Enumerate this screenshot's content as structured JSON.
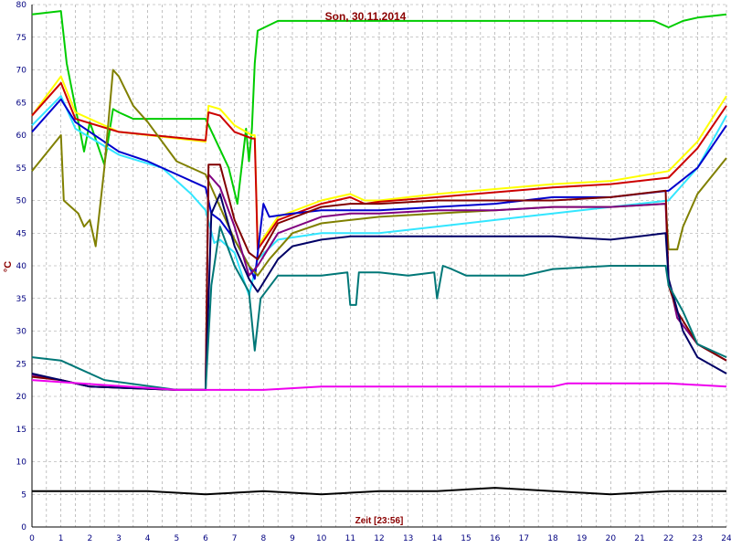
{
  "chart_data": {
    "type": "line",
    "title": "Son, 30.11.2014",
    "xlabel": "Zeit [23:56]",
    "ylabel": "°C",
    "xlim": [
      0,
      24
    ],
    "ylim": [
      0,
      80
    ],
    "x_ticks": [
      "0",
      "1",
      "2",
      "3",
      "4",
      "5",
      "6",
      "7",
      "8",
      "9",
      "10",
      "11",
      "12",
      "13",
      "14",
      "15",
      "16",
      "17",
      "18",
      "19",
      "20",
      "21",
      "22",
      "23",
      "24"
    ],
    "y_ticks": [
      "0",
      "5",
      "10",
      "15",
      "20",
      "25",
      "30",
      "35",
      "40",
      "45",
      "50",
      "55",
      "60",
      "65",
      "70",
      "75",
      "80"
    ],
    "x_minor_step": 0.5,
    "y_step": 5,
    "grid": true,
    "series": [
      {
        "color": "#00cc00",
        "points": [
          [
            0,
            78.5
          ],
          [
            1,
            79
          ],
          [
            1.2,
            71
          ],
          [
            1.6,
            62
          ],
          [
            1.8,
            57.5
          ],
          [
            2,
            62
          ],
          [
            2.5,
            55.5
          ],
          [
            2.8,
            64
          ],
          [
            3,
            63.5
          ],
          [
            3.5,
            62.5
          ],
          [
            4,
            62.5
          ],
          [
            5,
            62.5
          ],
          [
            6,
            62.5
          ],
          [
            6.8,
            55
          ],
          [
            7.1,
            49.5
          ],
          [
            7.4,
            61
          ],
          [
            7.5,
            56
          ],
          [
            7.6,
            61
          ],
          [
            7.7,
            71
          ],
          [
            7.8,
            76
          ],
          [
            8.5,
            77.5
          ],
          [
            9,
            77.5
          ],
          [
            10,
            77.5
          ],
          [
            15,
            77.5
          ],
          [
            20,
            77.5
          ],
          [
            21.5,
            77.5
          ],
          [
            22,
            76.5
          ],
          [
            22.5,
            77.5
          ],
          [
            23,
            78
          ],
          [
            24,
            78.5
          ]
        ]
      },
      {
        "color": "#ffff00",
        "points": [
          [
            0,
            63
          ],
          [
            1,
            69
          ],
          [
            1.5,
            63.5
          ],
          [
            3,
            60.5
          ],
          [
            6,
            59
          ],
          [
            6.1,
            64.5
          ],
          [
            6.5,
            64
          ],
          [
            7,
            61.5
          ],
          [
            7.6,
            60
          ],
          [
            7.7,
            60
          ],
          [
            7.8,
            43
          ],
          [
            8.5,
            47.5
          ],
          [
            10,
            50
          ],
          [
            11,
            51
          ],
          [
            11.5,
            50
          ],
          [
            12,
            50
          ],
          [
            14,
            51
          ],
          [
            18,
            52.5
          ],
          [
            20,
            53
          ],
          [
            22,
            54.5
          ],
          [
            23,
            59
          ],
          [
            24,
            66
          ]
        ]
      },
      {
        "color": "#cc0000",
        "points": [
          [
            0,
            63
          ],
          [
            1,
            68
          ],
          [
            1.5,
            62.5
          ],
          [
            3,
            60.5
          ],
          [
            6,
            59.2
          ],
          [
            6.1,
            63.5
          ],
          [
            6.5,
            63
          ],
          [
            7,
            60.5
          ],
          [
            7.6,
            59.5
          ],
          [
            7.7,
            59.5
          ],
          [
            7.8,
            42.5
          ],
          [
            8.5,
            47
          ],
          [
            10,
            49.5
          ],
          [
            11,
            50.5
          ],
          [
            11.5,
            49.5
          ],
          [
            12,
            49.8
          ],
          [
            14,
            50.5
          ],
          [
            18,
            52
          ],
          [
            20,
            52.5
          ],
          [
            22,
            53.5
          ],
          [
            23,
            58
          ],
          [
            24,
            64.5
          ]
        ]
      },
      {
        "color": "#33e6ff",
        "points": [
          [
            0,
            61.5
          ],
          [
            1,
            66
          ],
          [
            1.5,
            61
          ],
          [
            3,
            57
          ],
          [
            4.5,
            55
          ],
          [
            5.5,
            51
          ],
          [
            6,
            48.5
          ],
          [
            6.3,
            43.5
          ],
          [
            6.5,
            44
          ],
          [
            7,
            42
          ],
          [
            7.3,
            38
          ],
          [
            7.5,
            35.5
          ],
          [
            7.8,
            41
          ],
          [
            8.5,
            44
          ],
          [
            10,
            45
          ],
          [
            11,
            45
          ],
          [
            12,
            45
          ],
          [
            14,
            46
          ],
          [
            16,
            47
          ],
          [
            18,
            48
          ],
          [
            20,
            49
          ],
          [
            22,
            50
          ],
          [
            23,
            55
          ],
          [
            24,
            63
          ]
        ]
      },
      {
        "color": "#0000cc",
        "points": [
          [
            0,
            60.5
          ],
          [
            1,
            65.5
          ],
          [
            1.5,
            62
          ],
          [
            3,
            57.5
          ],
          [
            4,
            56
          ],
          [
            5,
            54
          ],
          [
            6,
            52
          ],
          [
            6.2,
            48
          ],
          [
            6.5,
            47
          ],
          [
            7,
            44
          ],
          [
            7.5,
            40
          ],
          [
            7.7,
            38
          ],
          [
            8,
            49.5
          ],
          [
            8.2,
            47.5
          ],
          [
            9,
            48
          ],
          [
            10,
            48.5
          ],
          [
            11,
            48.5
          ],
          [
            12,
            48.5
          ],
          [
            14,
            49
          ],
          [
            16,
            49.5
          ],
          [
            18,
            50.5
          ],
          [
            20,
            50.5
          ],
          [
            22,
            51.5
          ],
          [
            23,
            55
          ],
          [
            24,
            61.5
          ]
        ]
      },
      {
        "color": "#808000",
        "points": [
          [
            0,
            54.5
          ],
          [
            1,
            60
          ],
          [
            1.1,
            50
          ],
          [
            1.6,
            48
          ],
          [
            1.8,
            46
          ],
          [
            2,
            47
          ],
          [
            2.2,
            43
          ],
          [
            2.5,
            55
          ],
          [
            2.8,
            70
          ],
          [
            3,
            69
          ],
          [
            3.5,
            64.5
          ],
          [
            4,
            62
          ],
          [
            5,
            56
          ],
          [
            6,
            54
          ],
          [
            6.5,
            49
          ],
          [
            7,
            44
          ],
          [
            7.5,
            40
          ],
          [
            7.8,
            38.5
          ],
          [
            8.2,
            41
          ],
          [
            9,
            45
          ],
          [
            10,
            46.5
          ],
          [
            11,
            47
          ],
          [
            12,
            47.5
          ],
          [
            14,
            48
          ],
          [
            16,
            48.5
          ],
          [
            18,
            49
          ],
          [
            20,
            49
          ],
          [
            21.9,
            49.5
          ],
          [
            22,
            42.5
          ],
          [
            22.3,
            42.5
          ],
          [
            22.5,
            46
          ],
          [
            23,
            51
          ],
          [
            24,
            56.5
          ]
        ]
      },
      {
        "color": "#800080",
        "points": [
          [
            0,
            23.3
          ],
          [
            1,
            22.5
          ],
          [
            2,
            21.5
          ],
          [
            5,
            21
          ],
          [
            6,
            21
          ],
          [
            6.1,
            54
          ],
          [
            6.5,
            52
          ],
          [
            7,
            46
          ],
          [
            7.5,
            38.5
          ],
          [
            7.8,
            40
          ],
          [
            8.5,
            45
          ],
          [
            10,
            47.5
          ],
          [
            11,
            48
          ],
          [
            12,
            48
          ],
          [
            14,
            48.5
          ],
          [
            16,
            48.5
          ],
          [
            18,
            49
          ],
          [
            20,
            49
          ],
          [
            21.9,
            49.5
          ],
          [
            22,
            38
          ],
          [
            22.3,
            32
          ],
          [
            23,
            28
          ],
          [
            24,
            25.5
          ]
        ]
      },
      {
        "color": "#800000",
        "points": [
          [
            0,
            23
          ],
          [
            1,
            22.5
          ],
          [
            2,
            21.5
          ],
          [
            5,
            21
          ],
          [
            6,
            21
          ],
          [
            6.1,
            55.5
          ],
          [
            6.5,
            55.5
          ],
          [
            7,
            47
          ],
          [
            7.5,
            42
          ],
          [
            7.8,
            41
          ],
          [
            8.5,
            46.5
          ],
          [
            10,
            49
          ],
          [
            11,
            49.5
          ],
          [
            12,
            49.5
          ],
          [
            14,
            50
          ],
          [
            16,
            50
          ],
          [
            18,
            50
          ],
          [
            20,
            50.5
          ],
          [
            21.9,
            51.5
          ],
          [
            22,
            37
          ],
          [
            22.3,
            33
          ],
          [
            23,
            28
          ],
          [
            24,
            25.5
          ]
        ]
      },
      {
        "color": "#000066",
        "points": [
          [
            0,
            23.5
          ],
          [
            1,
            22.5
          ],
          [
            2,
            21.5
          ],
          [
            5,
            21
          ],
          [
            6,
            21
          ],
          [
            6.2,
            48
          ],
          [
            6.5,
            51
          ],
          [
            7,
            43
          ],
          [
            7.5,
            38
          ],
          [
            7.8,
            36
          ],
          [
            8.5,
            41
          ],
          [
            9,
            43
          ],
          [
            10,
            44
          ],
          [
            11,
            44.5
          ],
          [
            12,
            44.5
          ],
          [
            14,
            44.5
          ],
          [
            16,
            44.5
          ],
          [
            18,
            44.5
          ],
          [
            20,
            44
          ],
          [
            21,
            44.5
          ],
          [
            21.9,
            45
          ],
          [
            22,
            38
          ],
          [
            22.5,
            30
          ],
          [
            23,
            26
          ],
          [
            24,
            23.5
          ]
        ]
      },
      {
        "color": "#007777",
        "points": [
          [
            0,
            26
          ],
          [
            1,
            25.5
          ],
          [
            1.5,
            24.5
          ],
          [
            2.5,
            22.5
          ],
          [
            5,
            21
          ],
          [
            6,
            21
          ],
          [
            6.2,
            37
          ],
          [
            6.5,
            46
          ],
          [
            7,
            40
          ],
          [
            7.5,
            36
          ],
          [
            7.7,
            27
          ],
          [
            7.9,
            35
          ],
          [
            8.5,
            38.5
          ],
          [
            10,
            38.5
          ],
          [
            10.9,
            39
          ],
          [
            11,
            34
          ],
          [
            11.2,
            34
          ],
          [
            11.3,
            39
          ],
          [
            12,
            39
          ],
          [
            13,
            38.5
          ],
          [
            13.9,
            39
          ],
          [
            14,
            35
          ],
          [
            14.2,
            40
          ],
          [
            14.5,
            39.5
          ],
          [
            15,
            38.5
          ],
          [
            17,
            38.5
          ],
          [
            18,
            39.5
          ],
          [
            20,
            40
          ],
          [
            21,
            40
          ],
          [
            21.9,
            40
          ],
          [
            22,
            37
          ],
          [
            22.5,
            33
          ],
          [
            23,
            28
          ],
          [
            24,
            26
          ]
        ]
      },
      {
        "color": "#ee00ee",
        "points": [
          [
            0,
            22.5
          ],
          [
            5,
            21
          ],
          [
            6,
            21
          ],
          [
            7.5,
            21
          ],
          [
            8,
            21
          ],
          [
            10,
            21.5
          ],
          [
            12,
            21.5
          ],
          [
            15,
            21.5
          ],
          [
            17,
            21.5
          ],
          [
            18,
            21.5
          ],
          [
            18.5,
            22
          ],
          [
            20,
            22
          ],
          [
            22,
            22
          ],
          [
            24,
            21.5
          ]
        ]
      },
      {
        "color": "#000000",
        "points": [
          [
            0,
            5.5
          ],
          [
            2,
            5.5
          ],
          [
            4,
            5.5
          ],
          [
            6,
            5
          ],
          [
            8,
            5.5
          ],
          [
            10,
            5
          ],
          [
            12,
            5.5
          ],
          [
            14,
            5.5
          ],
          [
            16,
            6
          ],
          [
            18,
            5.5
          ],
          [
            20,
            5
          ],
          [
            22,
            5.5
          ],
          [
            24,
            5.5
          ]
        ]
      }
    ]
  }
}
